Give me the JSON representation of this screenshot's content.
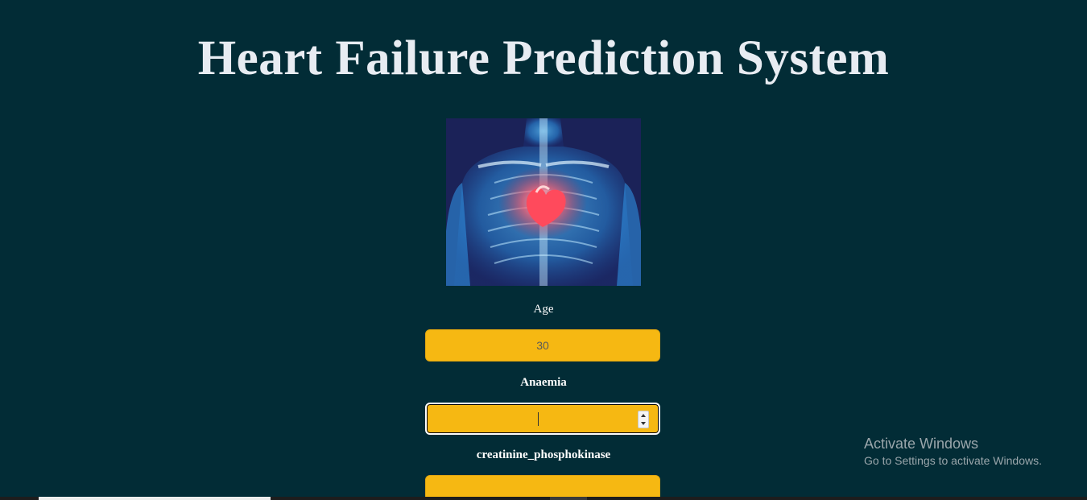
{
  "header": {
    "title": "Heart Failure Prediction System"
  },
  "hero": {
    "icon": "heart-xray-illustration"
  },
  "form": {
    "fields": [
      {
        "label": "Age",
        "value": "30",
        "placeholder": ""
      },
      {
        "label": "Anaemia",
        "value": "",
        "placeholder": ""
      },
      {
        "label": "creatinine_phosphokinase",
        "value": "",
        "placeholder": ""
      }
    ]
  },
  "watermark": {
    "title": "Activate Windows",
    "subtitle": "Go to Settings to activate Windows."
  },
  "colors": {
    "background": "#022c36",
    "input_fill": "#f6b812",
    "title_text": "#e8ecf2"
  }
}
